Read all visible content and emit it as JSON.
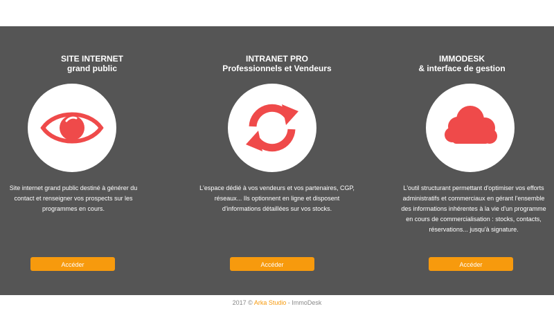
{
  "colors": {
    "panel_bg": "#555555",
    "accent": "#f79a0d",
    "icon_red": "#ef4a4a",
    "text_white": "#ffffff"
  },
  "cards": [
    {
      "title_line1": "SITE INTERNET",
      "title_line2": "grand public",
      "icon": "eye-icon",
      "description": "Site internet grand public destiné à générer du contact et renseigner vos prospects sur les programmes en cours.",
      "button_label": "Accéder"
    },
    {
      "title_line1": "INTRANET PRO",
      "title_line2": "Professionnels et Vendeurs",
      "icon": "refresh-icon",
      "description": "L'espace dédié à vos vendeurs et vos partenaires, CGP, réseaux... Ils optionnent en ligne et disposent d'informations détaillées sur vos stocks.",
      "button_label": "Accéder"
    },
    {
      "title_line1": "IMMODESK",
      "title_line2": "& interface de gestion",
      "icon": "cloud-icon",
      "description": "L'outil structurant permettant d'optimiser vos efforts administratifs et commerciaux en gérant l'ensemble des informations inhérentes à la vie d'un programme en cours de commercialisation : stocks, contacts, réservations... jusqu'à signature.",
      "button_label": "Accéder"
    }
  ],
  "footer": {
    "prefix": "2017 © ",
    "studio": "Arka Studio",
    "suffix": " - ImmoDesk"
  }
}
